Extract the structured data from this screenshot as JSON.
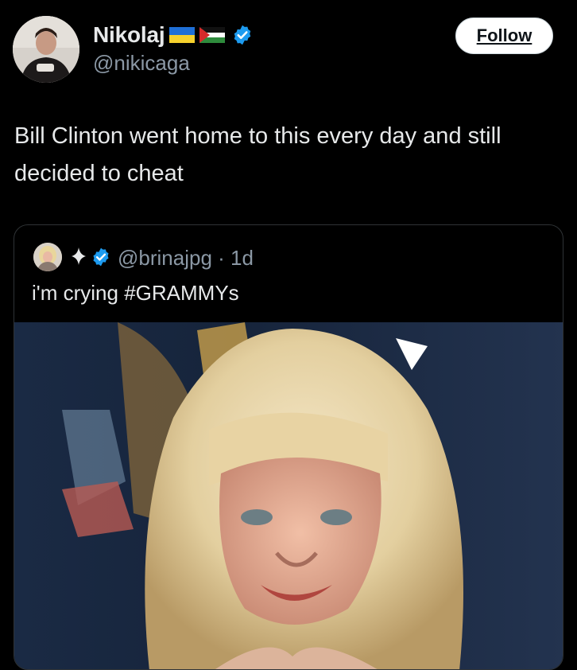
{
  "author": {
    "name": "Nikolaj",
    "handle": "@nikicaga",
    "avatar_icon": "person-photo-avatar",
    "flags": [
      "ukraine-flag-icon",
      "palestine-flag-icon"
    ],
    "verified_icon": "verified-badge-icon"
  },
  "follow_label": "Follow",
  "tweet_text": "Bill Clinton went home to this every day and still decided to cheat",
  "quote": {
    "handle_time": "@brinajpg · 1d",
    "text": "i'm crying #GRAMMYs",
    "avatar_icon": "blonde-person-avatar",
    "sparkle_icon": "sparkle-icon",
    "verified_icon": "verified-badge-icon",
    "media_icon": "video-still-blonde-woman"
  },
  "colors": {
    "background": "#000000",
    "text": "#e7e9ea",
    "secondary_text": "#8b98a5",
    "verified_blue": "#1d9bf0",
    "border": "#2f3336"
  }
}
